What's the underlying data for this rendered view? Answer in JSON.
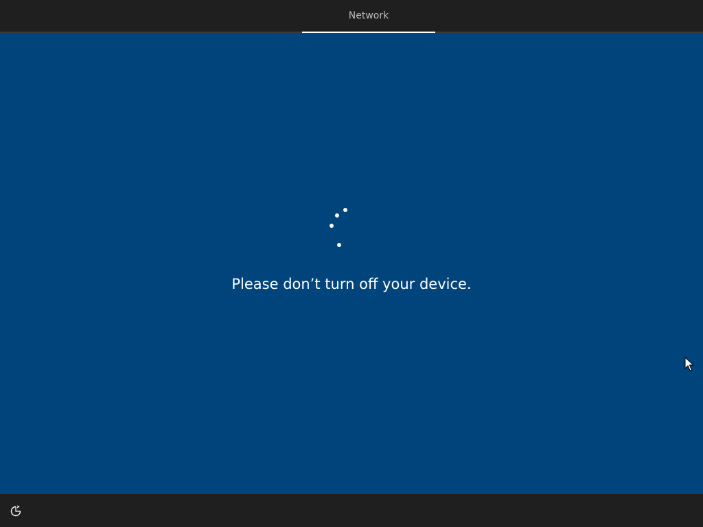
{
  "header": {
    "tabs": [
      {
        "label": "Network",
        "active": true
      }
    ]
  },
  "main": {
    "message": "Please don’t turn off your device.",
    "spinner_icon": "loading-spinner-icon"
  },
  "footer": {
    "ease_of_access_icon": "ease-of-access-icon"
  },
  "colors": {
    "background": "#00447c",
    "bar": "#1f1f1f",
    "text": "#ffffff",
    "tab_text": "#bdbdbd"
  }
}
